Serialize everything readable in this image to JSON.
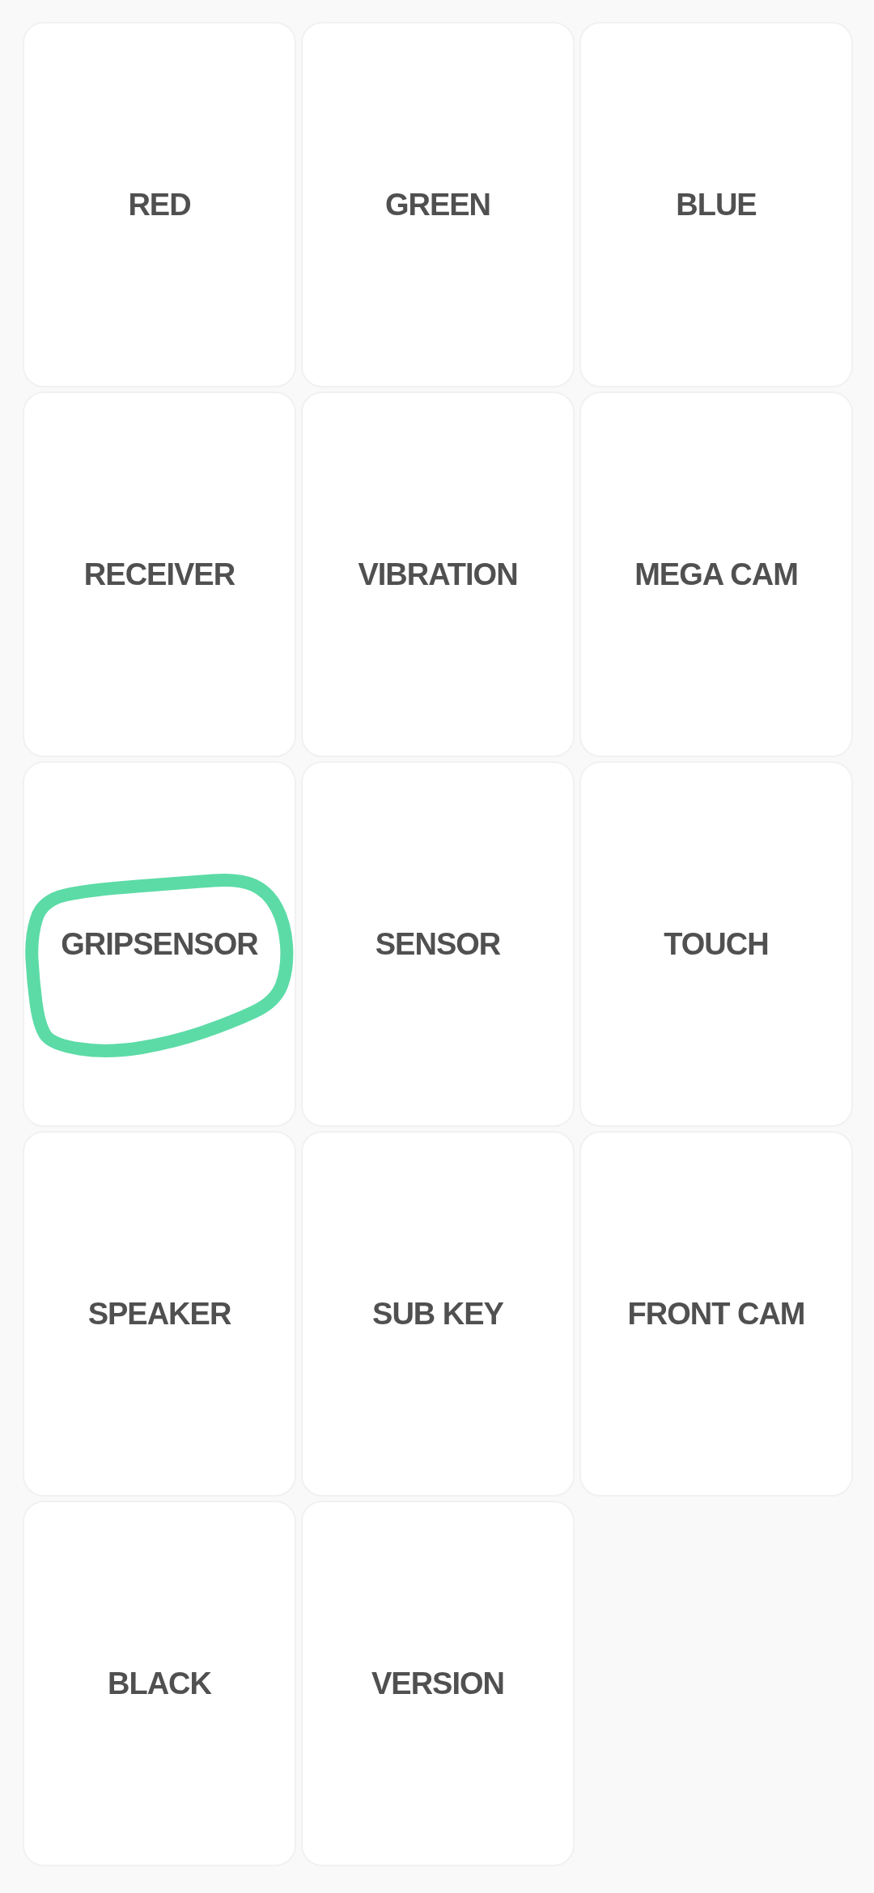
{
  "tiles": [
    {
      "label": "RED",
      "circled": false
    },
    {
      "label": "GREEN",
      "circled": false
    },
    {
      "label": "BLUE",
      "circled": false
    },
    {
      "label": "RECEIVER",
      "circled": false
    },
    {
      "label": "VIBRATION",
      "circled": false
    },
    {
      "label": "MEGA CAM",
      "circled": false
    },
    {
      "label": "GRIPSENSOR",
      "circled": true
    },
    {
      "label": "SENSOR",
      "circled": false
    },
    {
      "label": "TOUCH",
      "circled": false
    },
    {
      "label": "SPEAKER",
      "circled": false
    },
    {
      "label": "SUB KEY",
      "circled": false
    },
    {
      "label": "FRONT CAM",
      "circled": false
    },
    {
      "label": "BLACK",
      "circled": false
    },
    {
      "label": "VERSION",
      "circled": false
    }
  ]
}
